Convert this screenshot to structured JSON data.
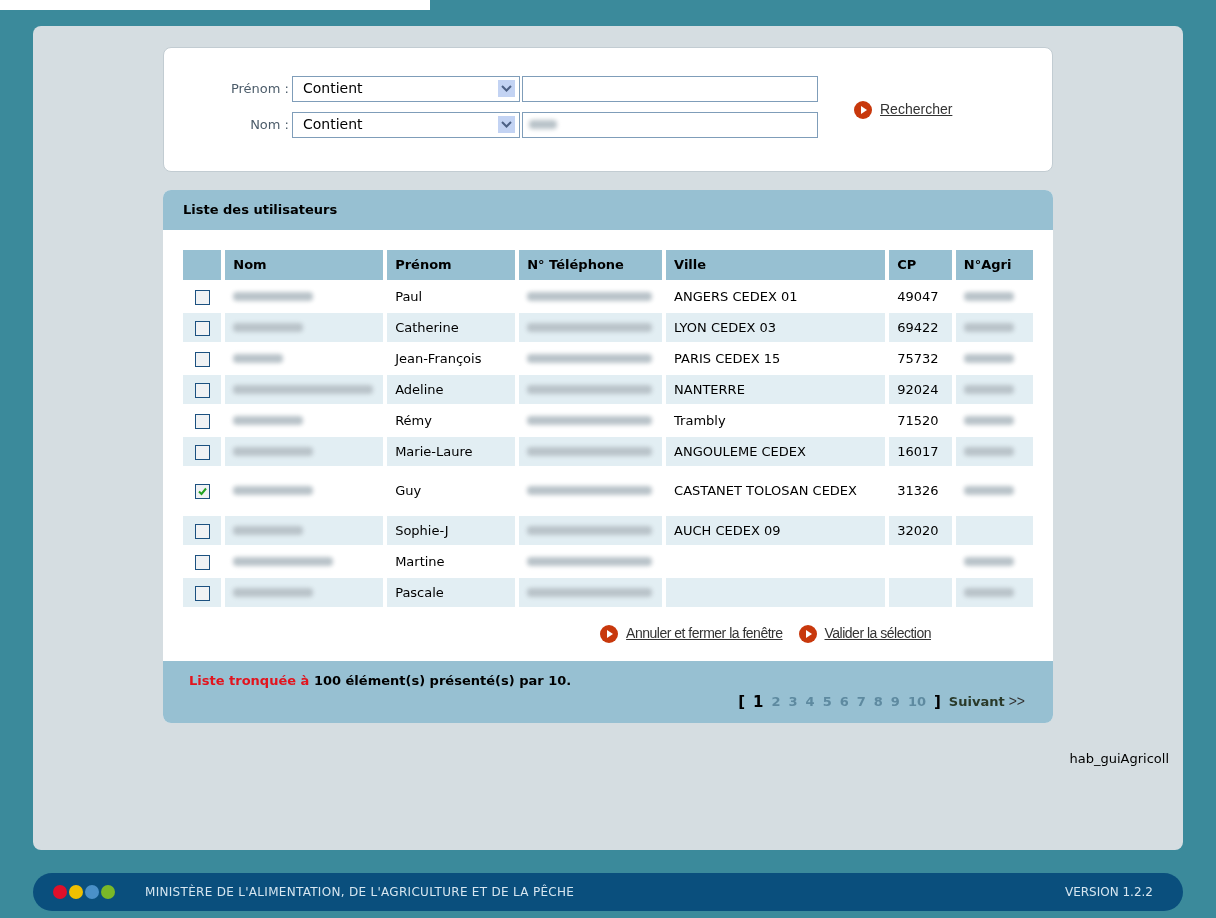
{
  "search": {
    "fields": [
      {
        "label": "Prénom :",
        "operator": "Contient",
        "value_redacted": false
      },
      {
        "label": "Nom :",
        "operator": "Contient",
        "value_redacted": true
      }
    ],
    "button": "Rechercher"
  },
  "list": {
    "title": "Liste des utilisateurs",
    "columns": [
      "Nom",
      "Prénom",
      "N° Téléphone",
      "Ville",
      "CP",
      "N°Agri"
    ],
    "rows": [
      {
        "checked": false,
        "nom_redacted": true,
        "prenom": "Paul",
        "tel_redacted": true,
        "ville": "ANGERS CEDEX 01",
        "cp": "49047",
        "agri_redacted": true
      },
      {
        "checked": false,
        "nom_redacted": true,
        "prenom": "Catherine",
        "tel_redacted": true,
        "ville": "LYON CEDEX 03",
        "cp": "69422",
        "agri_redacted": true
      },
      {
        "checked": false,
        "nom_redacted": true,
        "prenom": "Jean-François",
        "tel_redacted": true,
        "ville": "PARIS CEDEX 15",
        "cp": "75732",
        "agri_redacted": true
      },
      {
        "checked": false,
        "nom_redacted": true,
        "prenom": "Adeline",
        "tel_redacted": true,
        "ville": "NANTERRE",
        "cp": "92024",
        "agri_redacted": true
      },
      {
        "checked": false,
        "nom_redacted": true,
        "prenom": "Rémy",
        "tel_redacted": true,
        "ville": "Trambly",
        "cp": "71520",
        "agri_redacted": true
      },
      {
        "checked": false,
        "nom_redacted": true,
        "prenom": "Marie-Laure",
        "tel_redacted": true,
        "ville": "ANGOULEME CEDEX",
        "cp": "16017",
        "agri_redacted": true
      },
      {
        "checked": true,
        "nom_redacted": true,
        "prenom": "Guy",
        "tel_redacted": true,
        "ville": "CASTANET TOLOSAN CEDEX",
        "cp": "31326",
        "agri_redacted": true
      },
      {
        "checked": false,
        "nom_redacted": true,
        "prenom": "Sophie-J",
        "tel_redacted": true,
        "ville": "AUCH CEDEX 09",
        "cp": "32020",
        "agri_redacted": false
      },
      {
        "checked": false,
        "nom_redacted": true,
        "prenom": "Martine",
        "tel_redacted": true,
        "agri_redacted": true
      },
      {
        "checked": false,
        "nom_redacted": true,
        "prenom": "Pascale",
        "tel_redacted": true,
        "agri_redacted": true
      }
    ],
    "actions": [
      "Annuler et fermer la fenêtre",
      "Valider la sélection"
    ],
    "truncated_label": "Liste tronquée à",
    "truncated_text": "100 élément(s) présenté(s) par 10.",
    "pagination": {
      "open": "[",
      "pages": [
        {
          "label": "1",
          "selected": true
        },
        {
          "label": "2",
          "selected": false
        },
        {
          "label": "3",
          "selected": false
        },
        {
          "label": "4",
          "selected": false
        },
        {
          "label": "5",
          "selected": false
        },
        {
          "label": "6",
          "selected": false
        },
        {
          "label": "7",
          "selected": false
        },
        {
          "label": "8",
          "selected": false
        },
        {
          "label": "9",
          "selected": false
        },
        {
          "label": "10",
          "selected": false
        }
      ],
      "close": "]",
      "next": "Suivant",
      "next_arrow": ">>"
    }
  },
  "screen_id": "hab_guiAgricoll",
  "footer": {
    "dots": [
      {
        "color": "#e0102a"
      },
      {
        "color": "#f0c000"
      },
      {
        "color": "#4a90c8"
      },
      {
        "color": "#7ab828"
      }
    ],
    "ministry": "MINISTÈRE DE L'ALIMENTATION, DE L'AGRICULTURE ET DE LA PÊCHE",
    "version": "VERSION 1.2.2"
  }
}
